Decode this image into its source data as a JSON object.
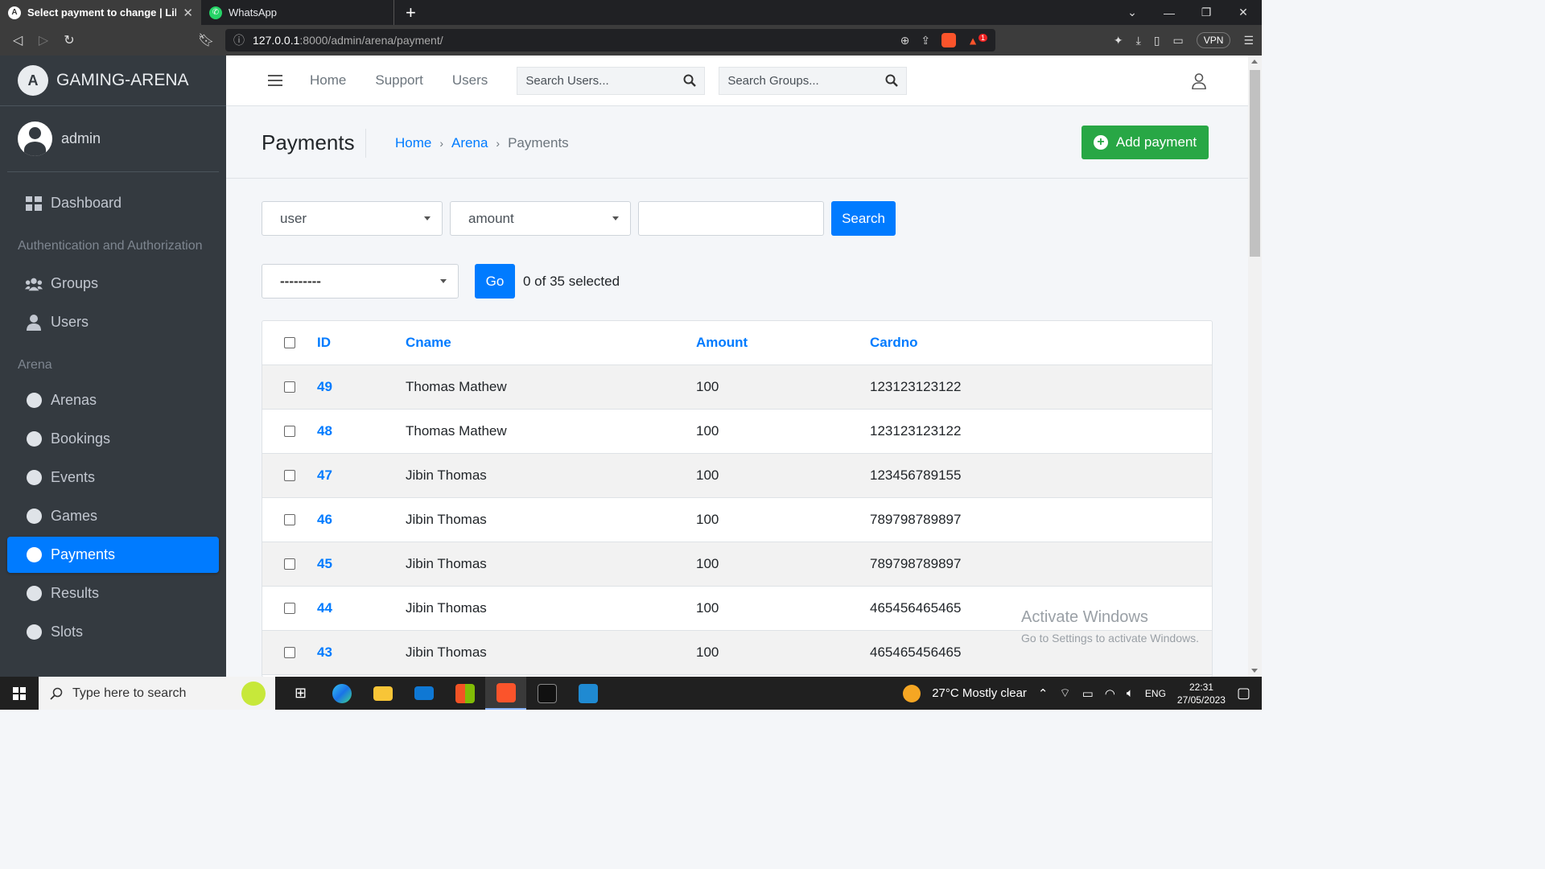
{
  "browser": {
    "tabs": [
      {
        "title": "Select payment to change | Library",
        "active": true
      },
      {
        "title": "WhatsApp",
        "active": false
      }
    ],
    "new_tab": "+",
    "url_host": "127.0.0.1",
    "url_path": ":8000/admin/arena/payment/",
    "vpn_label": "VPN",
    "notification_count": "1"
  },
  "sidebar": {
    "brand": "GAMING-ARENA",
    "user": "admin",
    "items": [
      {
        "label": "Dashboard",
        "icon": "dashboard-icon"
      },
      {
        "header": "Authentication and Authorization"
      },
      {
        "label": "Groups",
        "icon": "users-group-icon"
      },
      {
        "label": "Users",
        "icon": "user-icon"
      },
      {
        "header": "Arena"
      },
      {
        "label": "Arenas",
        "icon": "circle-icon"
      },
      {
        "label": "Bookings",
        "icon": "circle-icon"
      },
      {
        "label": "Events",
        "icon": "circle-icon"
      },
      {
        "label": "Games",
        "icon": "circle-icon"
      },
      {
        "label": "Payments",
        "icon": "circle-icon",
        "active": true
      },
      {
        "label": "Results",
        "icon": "circle-icon"
      },
      {
        "label": "Slots",
        "icon": "circle-icon"
      }
    ],
    "active_color": "#007bff"
  },
  "topnav": {
    "links": [
      "Home",
      "Support",
      "Users"
    ],
    "search_users_placeholder": "Search Users...",
    "search_groups_placeholder": "Search Groups..."
  },
  "header": {
    "title": "Payments",
    "breadcrumb": [
      "Home",
      "Arena",
      "Payments"
    ],
    "add_button": "Add payment"
  },
  "filters": {
    "select1": "user",
    "select2": "amount",
    "search_value": "",
    "search_button": "Search"
  },
  "actions": {
    "select_value": "---------",
    "go_button": "Go",
    "selected_text": "0 of 35 selected"
  },
  "table": {
    "columns": [
      "ID",
      "Cname",
      "Amount",
      "Cardno"
    ],
    "rows": [
      {
        "id": "49",
        "cname": "Thomas Mathew",
        "amount": "100",
        "cardno": "123123123122"
      },
      {
        "id": "48",
        "cname": "Thomas Mathew",
        "amount": "100",
        "cardno": "123123123122"
      },
      {
        "id": "47",
        "cname": "Jibin Thomas",
        "amount": "100",
        "cardno": "123456789155"
      },
      {
        "id": "46",
        "cname": "Jibin Thomas",
        "amount": "100",
        "cardno": "789798789897"
      },
      {
        "id": "45",
        "cname": "Jibin Thomas",
        "amount": "100",
        "cardno": "789798789897"
      },
      {
        "id": "44",
        "cname": "Jibin Thomas",
        "amount": "100",
        "cardno": "465456465465"
      },
      {
        "id": "43",
        "cname": "Jibin Thomas",
        "amount": "100",
        "cardno": "465465456465"
      }
    ]
  },
  "watermark": {
    "line1": "Activate Windows",
    "line2": "Go to Settings to activate Windows."
  },
  "taskbar": {
    "search_placeholder": "Type here to search",
    "weather": "27°C  Mostly clear",
    "language": "ENG",
    "time": "22:31",
    "date": "27/05/2023"
  }
}
